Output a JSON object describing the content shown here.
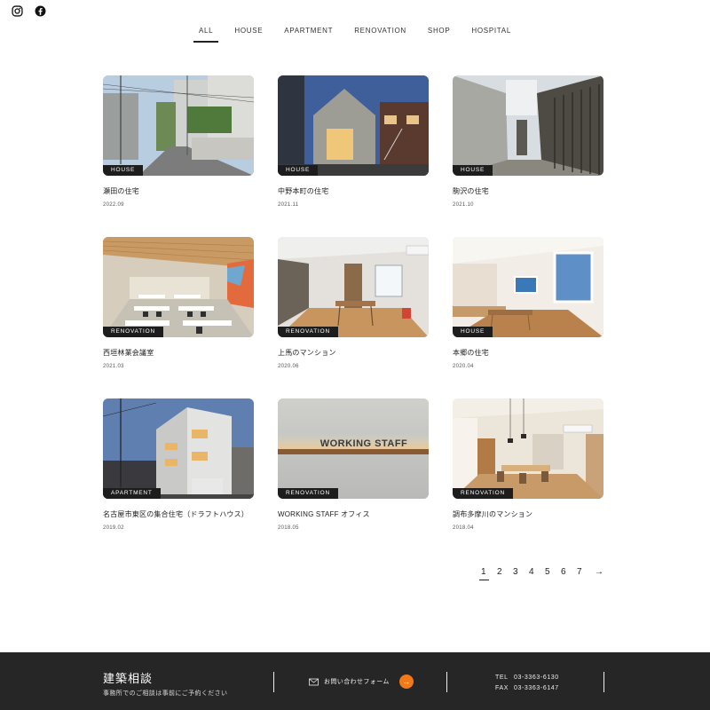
{
  "social": {
    "icons": [
      "instagram-icon",
      "facebook-icon"
    ]
  },
  "categories": [
    {
      "label": "ALL",
      "active": true
    },
    {
      "label": "HOUSE"
    },
    {
      "label": "APARTMENT"
    },
    {
      "label": "RENOVATION"
    },
    {
      "label": "SHOP"
    },
    {
      "label": "HOSPITAL"
    }
  ],
  "works": [
    {
      "tag": "HOUSE",
      "name": "瀬田の住宅",
      "date": "2022.09"
    },
    {
      "tag": "HOUSE",
      "name": "中野本町の住宅",
      "date": "2021.11"
    },
    {
      "tag": "HOUSE",
      "name": "駒沢の住宅",
      "date": "2021.10"
    },
    {
      "tag": "RENOVATION",
      "name": "西垣林業会議室",
      "date": "2021.03"
    },
    {
      "tag": "RENOVATION",
      "name": "上馬のマンション",
      "date": "2020.06"
    },
    {
      "tag": "HOUSE",
      "name": "本郷の住宅",
      "date": "2020.04"
    },
    {
      "tag": "APARTMENT",
      "name": "名古屋市東区の集合住宅（ドラフトハウス）",
      "date": "2019.02"
    },
    {
      "tag": "RENOVATION",
      "name": "WORKING STAFF オフィス",
      "date": "2018.05",
      "sign": "WORKING STAFF"
    },
    {
      "tag": "RENOVATION",
      "name": "調布多摩川のマンション",
      "date": "2018.04"
    }
  ],
  "pagination": {
    "pages": [
      "1",
      "2",
      "3",
      "4",
      "5",
      "6",
      "7"
    ],
    "current": "1",
    "next": "→"
  },
  "footer": {
    "title": "建築相談",
    "subtitle": "事務所でのご相談は事前にご予約ください",
    "contact_label": "お問い合わせフォーム",
    "tel_label": "TEL",
    "tel": "03-3363-6130",
    "fax_label": "FAX",
    "fax": "03-3363-6147",
    "accent": "#f07a1a"
  }
}
